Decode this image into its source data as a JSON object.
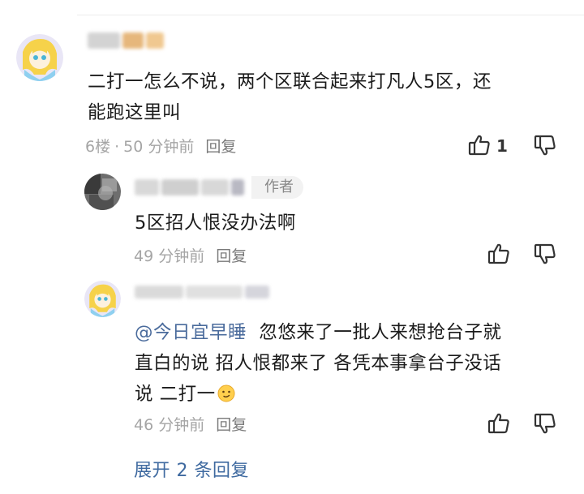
{
  "comments": [
    {
      "text": "二打一怎么不说，两个区联合起来打凡人5区，还能跑这里叫",
      "text_line1": "二打一怎么不说，两个区联合起来打凡人5区，还",
      "text_line2": "能跑这里叫",
      "floor": "6楼",
      "time": "50 分钟前",
      "reply_label": "回复",
      "like_count": "1"
    }
  ],
  "replies": [
    {
      "author_tag": "作者",
      "text": "5区招人恨没办法啊",
      "time": "49 分钟前",
      "reply_label": "回复"
    },
    {
      "mention": "@今日宜早睡",
      "line1_rest": "  忽悠来了一批人来想抢台子就",
      "line2": "直白的说 招人恨都来了 各凭本事拿台子没话",
      "line3": "说 二打一",
      "emoji": "smirk-face",
      "time": "46 分钟前",
      "reply_label": "回复"
    }
  ],
  "expand_replies_label": "展开 2 条回复",
  "colors": {
    "link": "#3f6aa0",
    "meta": "#a5a5a5",
    "text": "#1b1b1b"
  }
}
